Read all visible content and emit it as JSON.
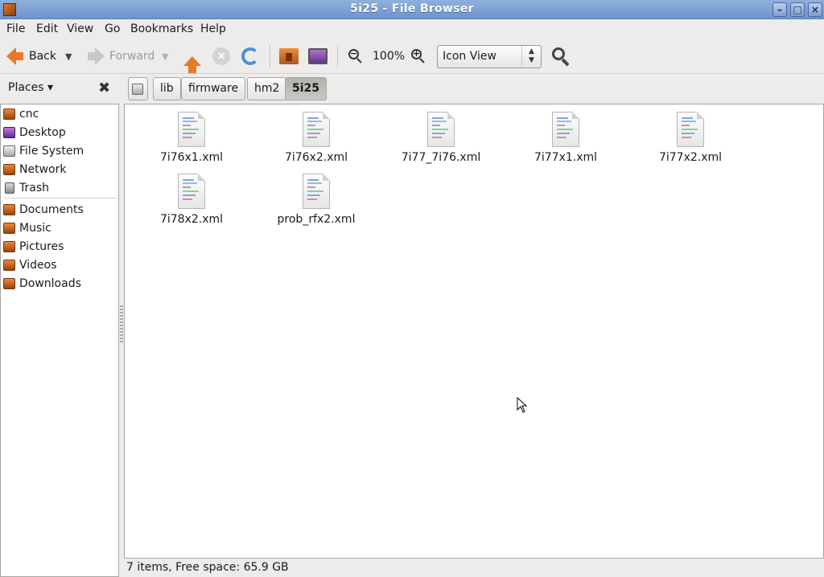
{
  "window": {
    "title": "5i25 - File Browser"
  },
  "menu": {
    "file": "File",
    "edit": "Edit",
    "view": "View",
    "go": "Go",
    "bookmarks": "Bookmarks",
    "help": "Help"
  },
  "toolbar": {
    "back_label": "Back",
    "forward_label": "Forward",
    "zoom_level": "100%",
    "view_mode": "Icon View"
  },
  "places": {
    "label": "Places"
  },
  "breadcrumb": [
    "lib",
    "firmware",
    "hm2",
    "5i25"
  ],
  "sidebar": {
    "items": [
      {
        "label": "cnc",
        "icon": "home-folder-icon"
      },
      {
        "label": "Desktop",
        "icon": "desktop-icon"
      },
      {
        "label": "File System",
        "icon": "drive-icon"
      },
      {
        "label": "Network",
        "icon": "network-icon"
      },
      {
        "label": "Trash",
        "icon": "trash-icon"
      }
    ],
    "bookmarks": [
      {
        "label": "Documents",
        "icon": "folder-icon"
      },
      {
        "label": "Music",
        "icon": "music-folder-icon"
      },
      {
        "label": "Pictures",
        "icon": "pictures-folder-icon"
      },
      {
        "label": "Videos",
        "icon": "videos-folder-icon"
      },
      {
        "label": "Downloads",
        "icon": "downloads-folder-icon"
      }
    ]
  },
  "files": [
    {
      "name": "7i76x1.xml"
    },
    {
      "name": "7i76x2.xml"
    },
    {
      "name": "7i77_7i76.xml"
    },
    {
      "name": "7i77x1.xml"
    },
    {
      "name": "7i77x2.xml"
    },
    {
      "name": "7i78x2.xml"
    },
    {
      "name": "prob_rfx2.xml"
    }
  ],
  "status": {
    "text": "7 items, Free space: 65.9 GB"
  },
  "colors": {
    "accent": "#e8782a",
    "titlebar": "#7fa2d4"
  }
}
